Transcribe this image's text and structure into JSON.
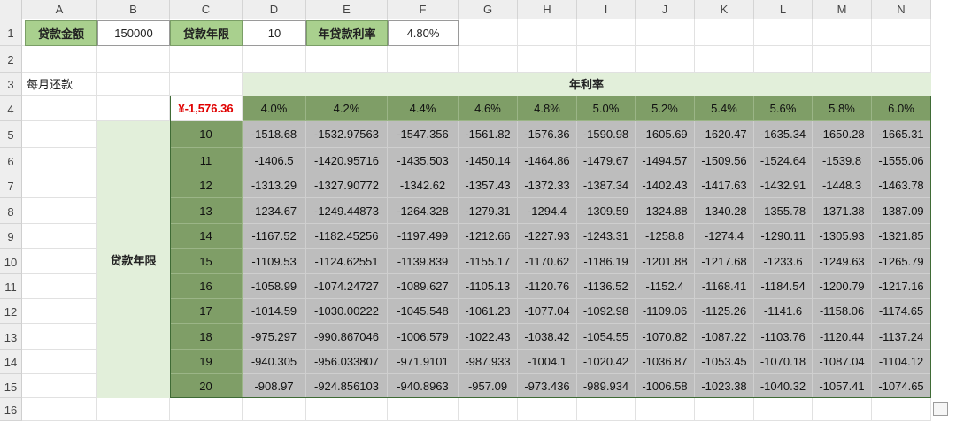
{
  "columns": [
    "A",
    "B",
    "C",
    "D",
    "E",
    "F",
    "G",
    "H",
    "I",
    "J",
    "K",
    "L",
    "M",
    "N"
  ],
  "rows": [
    "1",
    "2",
    "3",
    "4",
    "5",
    "6",
    "7",
    "8",
    "9",
    "10",
    "11",
    "12",
    "13",
    "14",
    "15",
    "16"
  ],
  "params": {
    "loan_amount_label": "贷款金额",
    "loan_amount": "150000",
    "loan_term_label": "贷款年限",
    "loan_term": "10",
    "annual_rate_label": "年贷款利率",
    "annual_rate": "4.80%"
  },
  "monthly_payment_label": "每月还款",
  "annual_rate_header": "年利率",
  "formula_result": "¥-1,576.36",
  "term_side_label": "贷款年限",
  "rates": [
    "4.0%",
    "4.2%",
    "4.4%",
    "4.6%",
    "4.8%",
    "5.0%",
    "5.2%",
    "5.4%",
    "5.6%",
    "5.8%",
    "6.0%"
  ],
  "terms": [
    "10",
    "11",
    "12",
    "13",
    "14",
    "15",
    "16",
    "17",
    "18",
    "19",
    "20"
  ],
  "payments": [
    [
      "-1518.68",
      "-1532.97563",
      "-1547.356",
      "-1561.82",
      "-1576.36",
      "-1590.98",
      "-1605.69",
      "-1620.47",
      "-1635.34",
      "-1650.28",
      "-1665.31"
    ],
    [
      "-1406.5",
      "-1420.95716",
      "-1435.503",
      "-1450.14",
      "-1464.86",
      "-1479.67",
      "-1494.57",
      "-1509.56",
      "-1524.64",
      "-1539.8",
      "-1555.06"
    ],
    [
      "-1313.29",
      "-1327.90772",
      "-1342.62",
      "-1357.43",
      "-1372.33",
      "-1387.34",
      "-1402.43",
      "-1417.63",
      "-1432.91",
      "-1448.3",
      "-1463.78"
    ],
    [
      "-1234.67",
      "-1249.44873",
      "-1264.328",
      "-1279.31",
      "-1294.4",
      "-1309.59",
      "-1324.88",
      "-1340.28",
      "-1355.78",
      "-1371.38",
      "-1387.09"
    ],
    [
      "-1167.52",
      "-1182.45256",
      "-1197.499",
      "-1212.66",
      "-1227.93",
      "-1243.31",
      "-1258.8",
      "-1274.4",
      "-1290.11",
      "-1305.93",
      "-1321.85"
    ],
    [
      "-1109.53",
      "-1124.62551",
      "-1139.839",
      "-1155.17",
      "-1170.62",
      "-1186.19",
      "-1201.88",
      "-1217.68",
      "-1233.6",
      "-1249.63",
      "-1265.79"
    ],
    [
      "-1058.99",
      "-1074.24727",
      "-1089.627",
      "-1105.13",
      "-1120.76",
      "-1136.52",
      "-1152.4",
      "-1168.41",
      "-1184.54",
      "-1200.79",
      "-1217.16"
    ],
    [
      "-1014.59",
      "-1030.00222",
      "-1045.548",
      "-1061.23",
      "-1077.04",
      "-1092.98",
      "-1109.06",
      "-1125.26",
      "-1141.6",
      "-1158.06",
      "-1174.65"
    ],
    [
      "-975.297",
      "-990.867046",
      "-1006.579",
      "-1022.43",
      "-1038.42",
      "-1054.55",
      "-1070.82",
      "-1087.22",
      "-1103.76",
      "-1120.44",
      "-1137.24"
    ],
    [
      "-940.305",
      "-956.033807",
      "-971.9101",
      "-987.933",
      "-1004.1",
      "-1020.42",
      "-1036.87",
      "-1053.45",
      "-1070.18",
      "-1087.04",
      "-1104.12"
    ],
    [
      "-908.97",
      "-924.856103",
      "-940.8963",
      "-957.09",
      "-973.436",
      "-989.934",
      "-1006.58",
      "-1023.38",
      "-1040.32",
      "-1057.41",
      "-1074.65"
    ]
  ]
}
